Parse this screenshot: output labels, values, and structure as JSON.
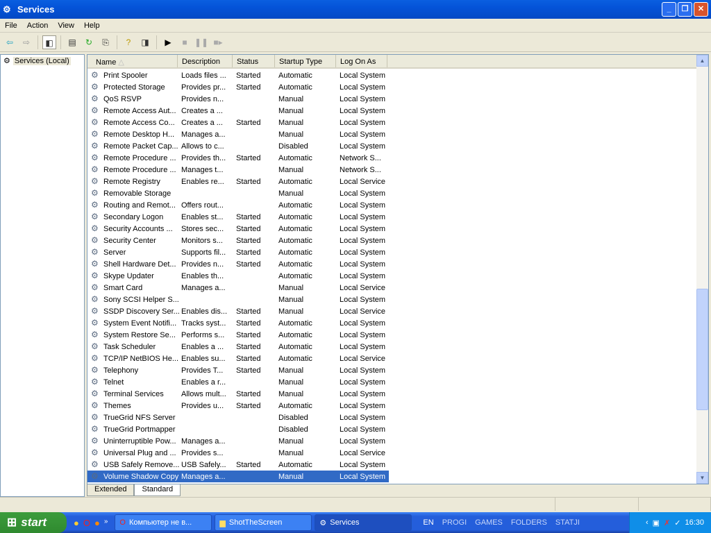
{
  "window": {
    "title": "Services"
  },
  "menu": [
    "File",
    "Action",
    "View",
    "Help"
  ],
  "tree": {
    "root": "Services (Local)"
  },
  "columns": [
    "Name",
    "Description",
    "Status",
    "Startup Type",
    "Log On As"
  ],
  "rows": [
    [
      "Print Spooler",
      "Loads files ...",
      "Started",
      "Automatic",
      "Local System"
    ],
    [
      "Protected Storage",
      "Provides pr...",
      "Started",
      "Automatic",
      "Local System"
    ],
    [
      "QoS RSVP",
      "Provides n...",
      "",
      "Manual",
      "Local System"
    ],
    [
      "Remote Access Aut...",
      "Creates a ...",
      "",
      "Manual",
      "Local System"
    ],
    [
      "Remote Access Co...",
      "Creates a ...",
      "Started",
      "Manual",
      "Local System"
    ],
    [
      "Remote Desktop H...",
      "Manages a...",
      "",
      "Manual",
      "Local System"
    ],
    [
      "Remote Packet Cap...",
      "Allows to c...",
      "",
      "Disabled",
      "Local System"
    ],
    [
      "Remote Procedure ...",
      "Provides th...",
      "Started",
      "Automatic",
      "Network S..."
    ],
    [
      "Remote Procedure ...",
      "Manages t...",
      "",
      "Manual",
      "Network S..."
    ],
    [
      "Remote Registry",
      "Enables re...",
      "Started",
      "Automatic",
      "Local Service"
    ],
    [
      "Removable Storage",
      "",
      "",
      "Manual",
      "Local System"
    ],
    [
      "Routing and Remot...",
      "Offers rout...",
      "",
      "Automatic",
      "Local System"
    ],
    [
      "Secondary Logon",
      "Enables st...",
      "Started",
      "Automatic",
      "Local System"
    ],
    [
      "Security Accounts ...",
      "Stores sec...",
      "Started",
      "Automatic",
      "Local System"
    ],
    [
      "Security Center",
      "Monitors s...",
      "Started",
      "Automatic",
      "Local System"
    ],
    [
      "Server",
      "Supports fil...",
      "Started",
      "Automatic",
      "Local System"
    ],
    [
      "Shell Hardware Det...",
      "Provides n...",
      "Started",
      "Automatic",
      "Local System"
    ],
    [
      "Skype Updater",
      "Enables th...",
      "",
      "Automatic",
      "Local System"
    ],
    [
      "Smart Card",
      "Manages a...",
      "",
      "Manual",
      "Local Service"
    ],
    [
      "Sony SCSI Helper S...",
      "",
      "",
      "Manual",
      "Local System"
    ],
    [
      "SSDP Discovery Ser...",
      "Enables dis...",
      "Started",
      "Manual",
      "Local Service"
    ],
    [
      "System Event Notifi...",
      "Tracks syst...",
      "Started",
      "Automatic",
      "Local System"
    ],
    [
      "System Restore Se...",
      "Performs s...",
      "Started",
      "Automatic",
      "Local System"
    ],
    [
      "Task Scheduler",
      "Enables a ...",
      "Started",
      "Automatic",
      "Local System"
    ],
    [
      "TCP/IP NetBIOS He...",
      "Enables su...",
      "Started",
      "Automatic",
      "Local Service"
    ],
    [
      "Telephony",
      "Provides T...",
      "Started",
      "Manual",
      "Local System"
    ],
    [
      "Telnet",
      "Enables a r...",
      "",
      "Manual",
      "Local System"
    ],
    [
      "Terminal Services",
      "Allows mult...",
      "Started",
      "Manual",
      "Local System"
    ],
    [
      "Themes",
      "Provides u...",
      "Started",
      "Automatic",
      "Local System"
    ],
    [
      "TrueGrid NFS Server",
      "",
      "",
      "Disabled",
      "Local System"
    ],
    [
      "TrueGrid Portmapper",
      "",
      "",
      "Disabled",
      "Local System"
    ],
    [
      "Uninterruptible Pow...",
      "Manages a...",
      "",
      "Manual",
      "Local System"
    ],
    [
      "Universal Plug and ...",
      "Provides s...",
      "",
      "Manual",
      "Local Service"
    ],
    [
      "USB Safely Remove...",
      "USB Safely...",
      "Started",
      "Automatic",
      "Local System"
    ],
    [
      "Volume Shadow Copy",
      "Manages a...",
      "",
      "Manual",
      "Local System"
    ]
  ],
  "selected_row": 34,
  "tabs": [
    "Extended",
    "Standard"
  ],
  "taskbar": {
    "start": "start",
    "tasks": [
      "Компьютер не в...",
      "ShotTheScreen",
      "Services"
    ],
    "lang": "EN",
    "links": [
      "PROGI",
      "GAMES",
      "FOLDERS",
      "STATJI"
    ],
    "clock": "16:30"
  }
}
